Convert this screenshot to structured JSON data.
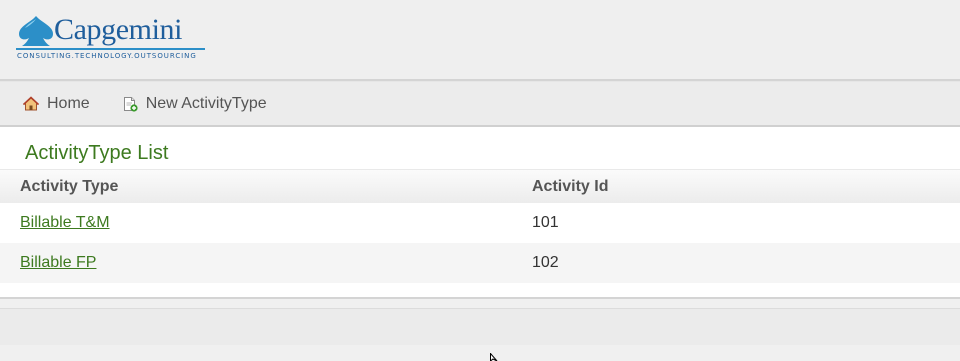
{
  "brand": {
    "name": "Capgemini",
    "tagline": "CONSULTING.TECHNOLOGY.OUTSOURCING",
    "primary_color": "#1f5e9c",
    "accent_color": "#2c8fc8"
  },
  "nav": {
    "items": [
      {
        "label": "Home",
        "icon": "home-icon"
      },
      {
        "label": "New ActivityType",
        "icon": "new-document-icon"
      }
    ]
  },
  "page": {
    "title": "ActivityType List",
    "title_color": "#3d7a1f"
  },
  "table": {
    "columns": [
      "Activity Type",
      "Activity Id"
    ],
    "rows": [
      {
        "activity_type": "Billable T&M",
        "activity_id": "101"
      },
      {
        "activity_type": "Billable FP",
        "activity_id": "102"
      }
    ]
  }
}
